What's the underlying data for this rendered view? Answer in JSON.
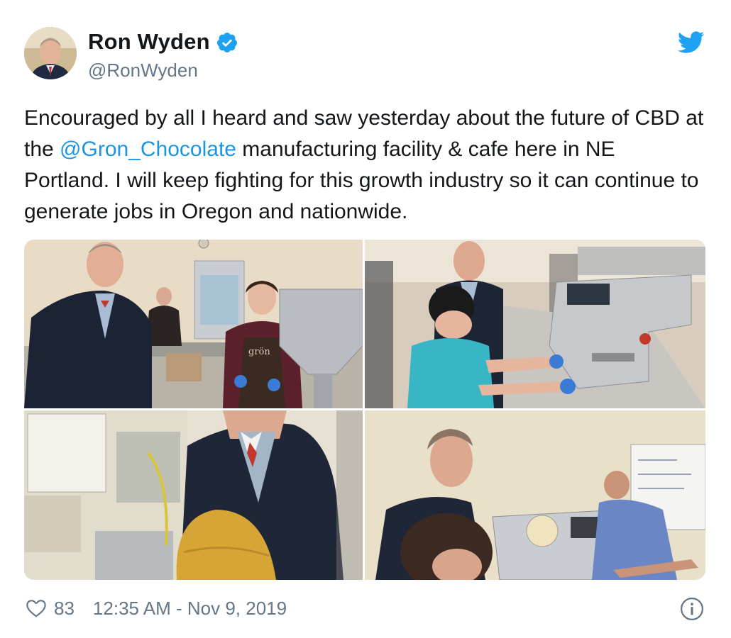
{
  "user": {
    "display_name": "Ron Wyden",
    "handle": "@RonWyden",
    "verified": true
  },
  "tweet": {
    "text_before": "Encouraged by all I heard and saw yesterday about the future of CBD at the ",
    "mention": "@Gron_Chocolate",
    "text_after": " manufacturing facility & cafe here in NE Portland. I will keep fighting for this growth industry so it can continue to generate jobs in Oregon and nationwide."
  },
  "photos": [
    {
      "apron_text": "grön"
    },
    {},
    {},
    {}
  ],
  "footer": {
    "likes": "83",
    "timestamp": "12:35 AM - Nov 9, 2019"
  },
  "colors": {
    "link": "#1b95e0",
    "twitter_blue": "#1da1f2",
    "muted": "#657786"
  },
  "icons": [
    "verified-badge-icon",
    "twitter-bird-icon",
    "heart-icon",
    "info-icon"
  ]
}
